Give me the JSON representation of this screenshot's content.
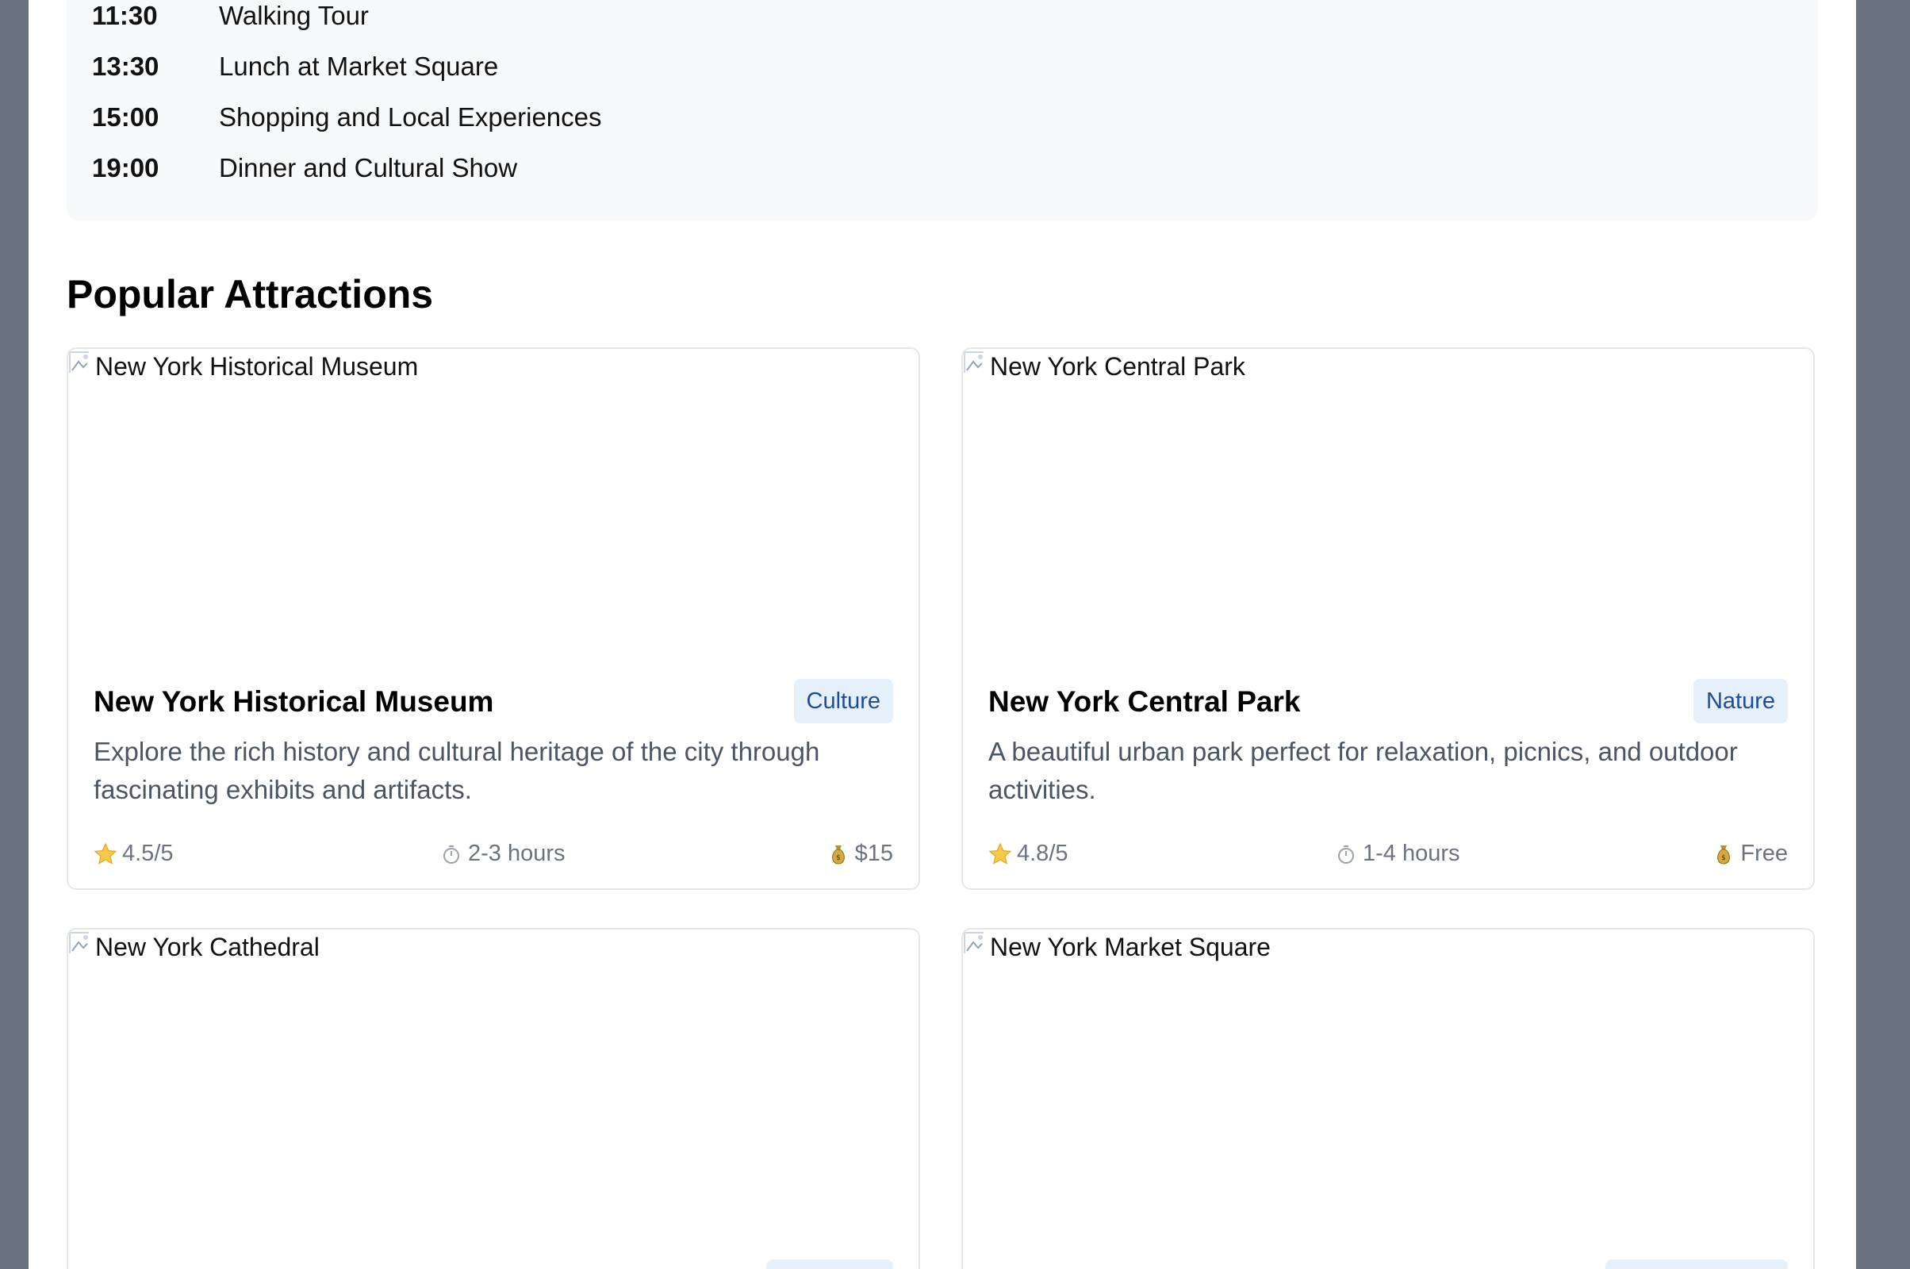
{
  "schedule": [
    {
      "time": "11:30",
      "activity": "Walking Tour"
    },
    {
      "time": "13:30",
      "activity": "Lunch at Market Square"
    },
    {
      "time": "15:00",
      "activity": "Shopping and Local Experiences"
    },
    {
      "time": "19:00",
      "activity": "Dinner and Cultural Show"
    }
  ],
  "attractions": {
    "title": "Popular Attractions",
    "cards": [
      {
        "image_alt": "New York Historical Museum",
        "name": "New York Historical Museum",
        "category": "Culture",
        "description": "Explore the rich history and cultural heritage of the city through fascinating exhibits and artifacts.",
        "rating": "4.5/5",
        "duration": "2-3 hours",
        "price": "$15"
      },
      {
        "image_alt": "New York Central Park",
        "name": "New York Central Park",
        "category": "Nature",
        "description": "A beautiful urban park perfect for relaxation, picnics, and outdoor activities.",
        "rating": "4.8/5",
        "duration": "1-4 hours",
        "price": "Free"
      },
      {
        "image_alt": "New York Cathedral"
      },
      {
        "image_alt": "New York Market Square"
      }
    ]
  },
  "icons": {
    "rating": "star-icon",
    "duration": "stopwatch-icon",
    "price": "money-bag-icon",
    "image": "broken-image-icon"
  },
  "colors": {
    "page_background": "#ffffff",
    "outer_background": "#6b7280",
    "schedule_background": "#f8f9fb",
    "badge_background": "#e6f0fb",
    "badge_text": "#1e4b9a",
    "card_border": "#e5e7eb",
    "muted_text": "#6b7280"
  }
}
